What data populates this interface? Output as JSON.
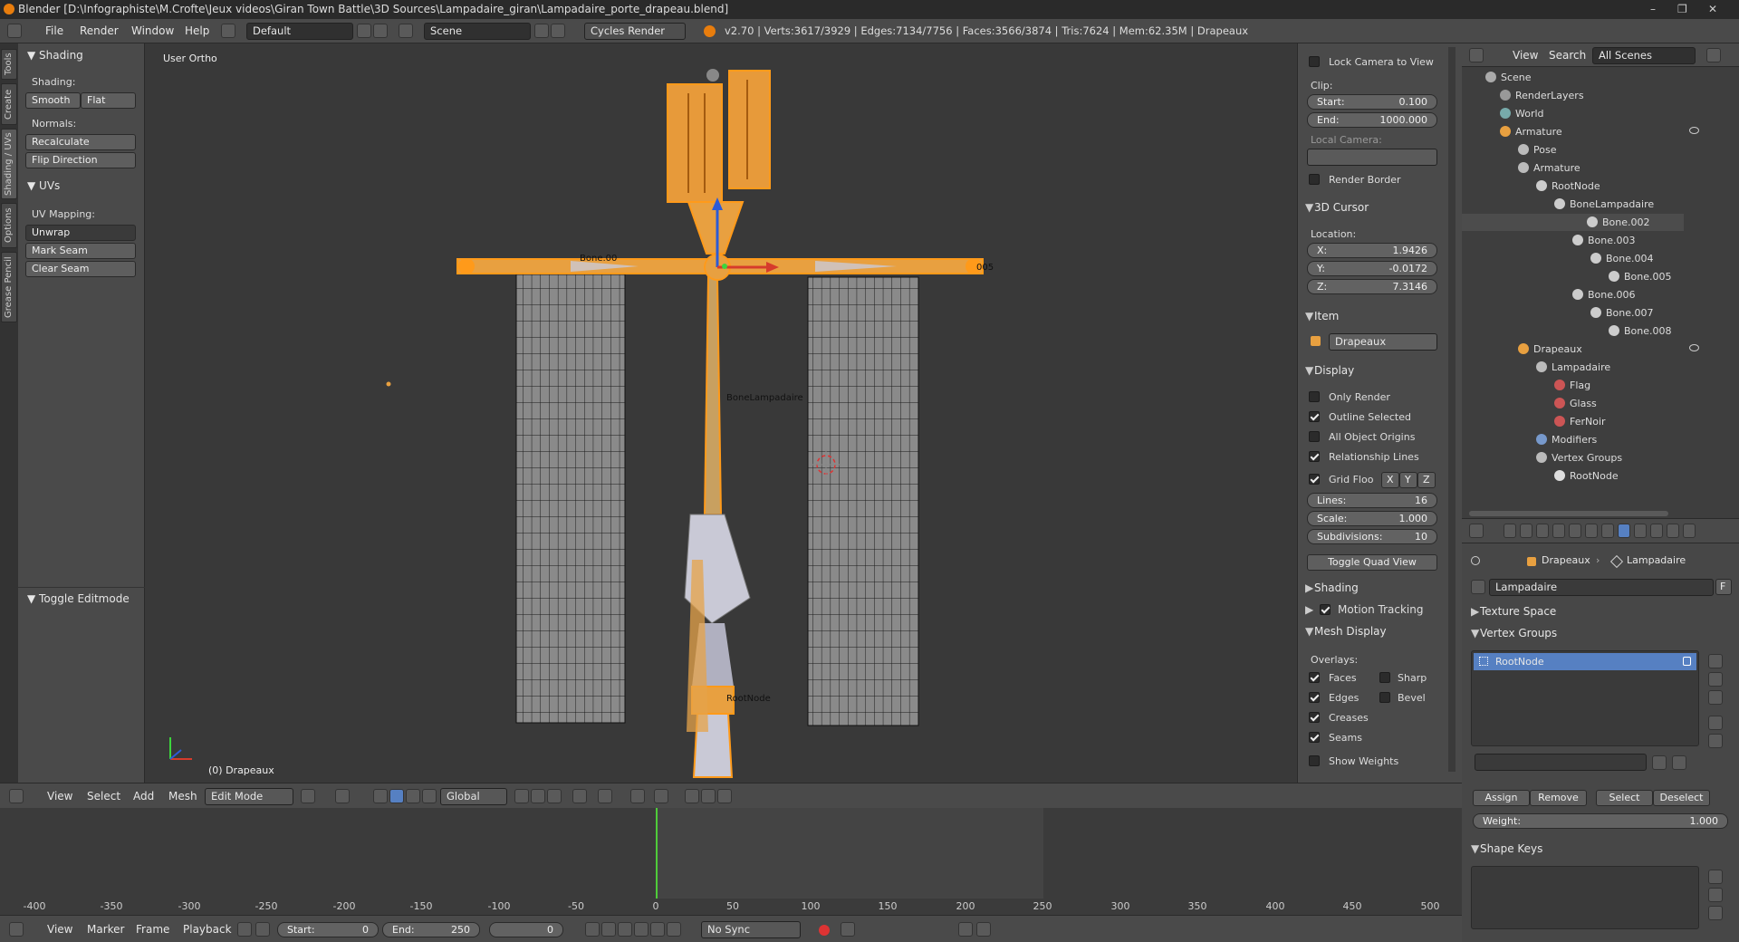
{
  "titlebar": {
    "title": "Blender [D:\\Infographiste\\M.Crofte\\Jeux videos\\Giran Town Battle\\3D Sources\\Lampadaire_giran\\Lampadaire_porte_drapeau.blend]",
    "minimize": "–",
    "maximize": "❐",
    "close": "✕"
  },
  "info_header": {
    "menus": [
      "File",
      "Render",
      "Window",
      "Help"
    ],
    "layout": "Default",
    "scene": "Scene",
    "engine": "Cycles Render",
    "stats": "v2.70 | Verts:3617/3929 | Edges:7134/7756 | Faces:3566/3874 | Tris:7624 | Mem:62.35M | Drapeaux"
  },
  "left_tabs": [
    "Tools",
    "Create",
    "Shading / UVs",
    "Options",
    "Grease Pencil"
  ],
  "tool_shelf": {
    "shading_title": "Shading",
    "shading_label": "Shading:",
    "smooth": "Smooth",
    "flat": "Flat",
    "normals_label": "Normals:",
    "recalculate": "Recalculate",
    "flip_direction": "Flip Direction",
    "uvs_title": "UVs",
    "uv_mapping_label": "UV Mapping:",
    "unwrap": "Unwrap",
    "mark_seam": "Mark Seam",
    "clear_seam": "Clear Seam",
    "toggle_editmode": "Toggle Editmode"
  },
  "viewport": {
    "view_name": "User Ortho",
    "object_label": "(0) Drapeaux",
    "bone_labels": {
      "bone002": "Bone.00",
      "bone005": "005",
      "bone_lamp": "BoneLampadaire",
      "root": "RootNode"
    }
  },
  "n_panel": {
    "lock_camera": "Lock Camera to View",
    "clip_label": "Clip:",
    "clip_start_label": "Start:",
    "clip_start": "0.100",
    "clip_end_label": "End:",
    "clip_end": "1000.000",
    "local_camera": "Local Camera:",
    "render_border": "Render Border",
    "cursor_title": "3D Cursor",
    "location_label": "Location:",
    "x_label": "X:",
    "x": "1.9426",
    "y_label": "Y:",
    "y": "-0.0172",
    "z_label": "Z:",
    "z": "7.3146",
    "item_title": "Item",
    "item_name": "Drapeaux",
    "display_title": "Display",
    "only_render": "Only Render",
    "outline_selected": "Outline Selected",
    "all_object_origins": "All Object Origins",
    "relationship_lines": "Relationship Lines",
    "grid_floor": "Grid Floo",
    "axis_x": "X",
    "axis_y": "Y",
    "axis_z": "Z",
    "lines_label": "Lines:",
    "lines": "16",
    "scale_label": "Scale:",
    "scale": "1.000",
    "subdivisions_label": "Subdivisions:",
    "subdivisions": "10",
    "toggle_quad": "Toggle Quad View",
    "shading_title": "Shading",
    "motion_tracking": "Motion Tracking",
    "mesh_display": "Mesh Display",
    "overlays_label": "Overlays:",
    "faces": "Faces",
    "sharp": "Sharp",
    "edges": "Edges",
    "bevel": "Bevel",
    "creases": "Creases",
    "seams": "Seams",
    "show_weights": "Show Weights"
  },
  "outliner": {
    "view": "View",
    "search": "Search",
    "filter": "All Scenes",
    "rows": [
      {
        "label": "Scene"
      },
      {
        "label": "RenderLayers"
      },
      {
        "label": "World"
      },
      {
        "label": "Armature"
      },
      {
        "label": "Pose"
      },
      {
        "label": "Armature"
      },
      {
        "label": "RootNode"
      },
      {
        "label": "BoneLampadaire"
      },
      {
        "label": "Bone.002"
      },
      {
        "label": "Bone.003"
      },
      {
        "label": "Bone.004"
      },
      {
        "label": "Bone.005"
      },
      {
        "label": "Bone.006"
      },
      {
        "label": "Bone.007"
      },
      {
        "label": "Bone.008"
      },
      {
        "label": "Drapeaux"
      },
      {
        "label": "Lampadaire"
      },
      {
        "label": "Flag"
      },
      {
        "label": "Glass"
      },
      {
        "label": "FerNoir"
      },
      {
        "label": "Modifiers"
      },
      {
        "label": "Vertex Groups"
      },
      {
        "label": "RootNode"
      }
    ]
  },
  "properties": {
    "breadcrumb_object": "Drapeaux",
    "breadcrumb_mesh": "Lampadaire",
    "mesh_name": "Lampadaire",
    "fake_user": "F",
    "texture_space": "Texture Space",
    "vertex_groups": "Vertex Groups",
    "vgroup_item": "RootNode",
    "assign": "Assign",
    "remove": "Remove",
    "select": "Select",
    "deselect": "Deselect",
    "weight_label": "Weight:",
    "weight": "1.000",
    "shape_keys": "Shape Keys"
  },
  "viewport_header": {
    "menus": [
      "View",
      "Select",
      "Add",
      "Mesh"
    ],
    "mode": "Edit Mode",
    "orientation": "Global"
  },
  "timeline": {
    "ticks": [
      "-400",
      "-350",
      "-300",
      "-250",
      "-200",
      "-150",
      "-100",
      "-50",
      "0",
      "50",
      "100",
      "150",
      "200",
      "250",
      "300",
      "350",
      "400",
      "450",
      "500"
    ],
    "menus": [
      "View",
      "Marker",
      "Frame",
      "Playback"
    ],
    "start_label": "Start:",
    "start": "0",
    "end_label": "End:",
    "end": "250",
    "current": "0",
    "sync": "No Sync"
  }
}
